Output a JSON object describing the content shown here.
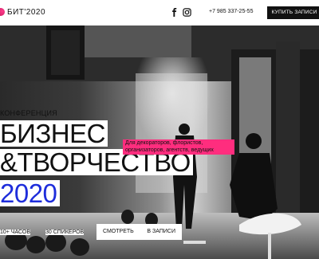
{
  "header": {
    "logo_text": "БИТ'2020",
    "phone": "+7 985 337-25-55",
    "buy_label": "КУПИТЬ ЗАПИСИ",
    "social": [
      "facebook-icon",
      "instagram-icon"
    ]
  },
  "hero": {
    "kicker": "КОНФЕРЕНЦИЯ",
    "title_line1": "БИЗНЕС",
    "title_line2": "&ТВОРЧЕСТВО",
    "title_line3": "2020",
    "note": "Для декораторов, флористов, организаторов, агентств, ведущих",
    "stats": [
      "10+ ЧАСОВ",
      "30 СПИКЕРОВ"
    ],
    "cta_left": "СМОТРЕТЬ",
    "cta_right": "В ЗАПИСИ"
  },
  "colors": {
    "accent_pink": "#ff2d7e",
    "year_blue": "#1e2ddb",
    "button_black": "#111111"
  }
}
